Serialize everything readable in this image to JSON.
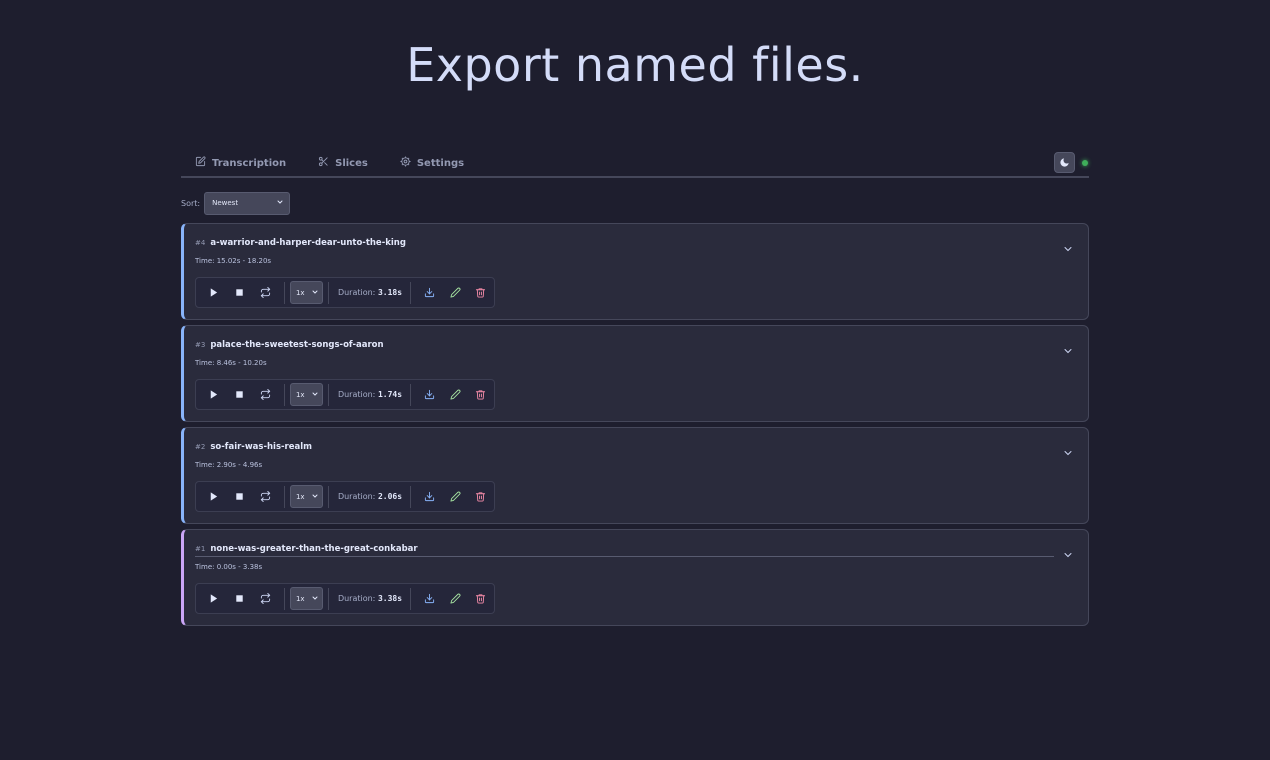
{
  "hero_title": "Export named files.",
  "tabs": [
    {
      "label": "Transcription",
      "icon": "edit-icon"
    },
    {
      "label": "Slices",
      "icon": "scissors-icon"
    },
    {
      "label": "Settings",
      "icon": "gear-icon"
    }
  ],
  "sort": {
    "label": "Sort:",
    "value": "Newest"
  },
  "colors": {
    "accent": "#89b4fa",
    "active_accent": "#cba6f7",
    "download": "#89b4fa",
    "rename": "#a6e3a1",
    "delete": "#f38ba8",
    "status": "#3fae5a"
  },
  "slices": [
    {
      "index": "#4",
      "name": "a-warrior-and-harper-dear-unto-the-king",
      "time": "Time: 15.02s - 18.20s",
      "speed": "1x",
      "duration_label": "Duration:",
      "duration": "3.18s"
    },
    {
      "index": "#3",
      "name": "palace-the-sweetest-songs-of-aaron",
      "time": "Time: 8.46s - 10.20s",
      "speed": "1x",
      "duration_label": "Duration:",
      "duration": "1.74s"
    },
    {
      "index": "#2",
      "name": "so-fair-was-his-realm",
      "time": "Time: 2.90s - 4.96s",
      "speed": "1x",
      "duration_label": "Duration:",
      "duration": "2.06s"
    },
    {
      "index": "#1",
      "name": "none-was-greater-than-the-great-conkabar",
      "time": "Time: 0.00s - 3.38s",
      "speed": "1x",
      "duration_label": "Duration:",
      "duration": "3.38s"
    }
  ]
}
